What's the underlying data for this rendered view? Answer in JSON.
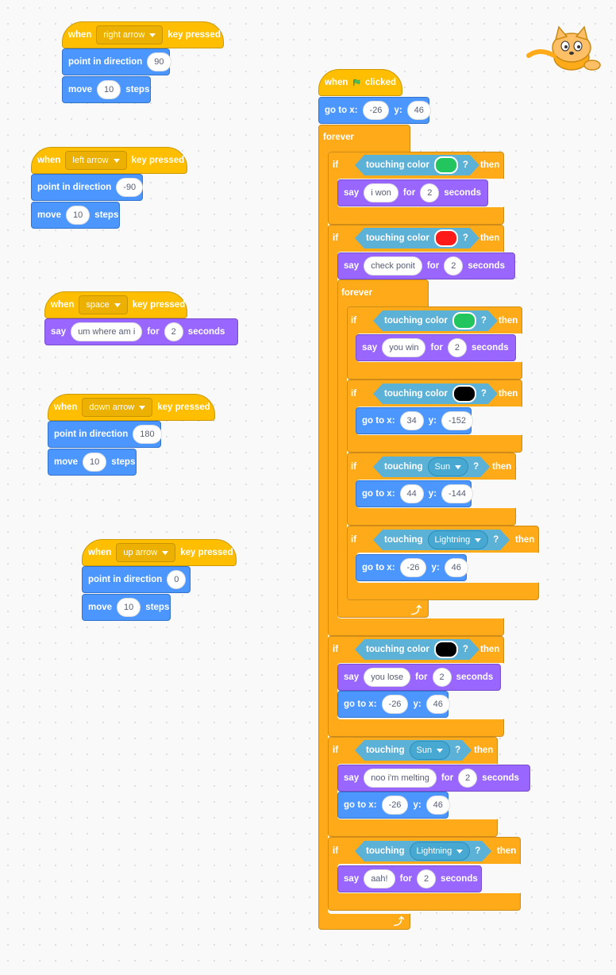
{
  "colors": {
    "event": "#ffbf00",
    "motion": "#4c97ff",
    "looks": "#9966ff",
    "control": "#ffab19",
    "sensing": "#5cb1d6",
    "green": "#22c55e",
    "red": "#ff1a1a",
    "black": "#000000"
  },
  "sprite": {
    "icon": "scratch-cat-icon"
  },
  "scripts": {
    "right": {
      "when": "when",
      "key": "right arrow",
      "pressed": "key pressed",
      "point": "point in direction",
      "dir": "90",
      "move": "move",
      "steps_val": "10",
      "steps": "steps"
    },
    "left": {
      "when": "when",
      "key": "left arrow",
      "pressed": "key pressed",
      "point": "point in direction",
      "dir": "-90",
      "move": "move",
      "steps_val": "10",
      "steps": "steps"
    },
    "space": {
      "when": "when",
      "key": "space",
      "pressed": "key pressed",
      "say": "say",
      "msg": "um where am i",
      "for": "for",
      "secs": "2",
      "seconds": "seconds"
    },
    "down": {
      "when": "when",
      "key": "down arrow",
      "pressed": "key pressed",
      "point": "point in direction",
      "dir": "180",
      "move": "move",
      "steps_val": "10",
      "steps": "steps"
    },
    "up": {
      "when": "when",
      "key": "up arrow",
      "pressed": "key pressed",
      "point": "point in direction",
      "dir": "0",
      "move": "move",
      "steps_val": "10",
      "steps": "steps"
    }
  },
  "main": {
    "when": "when",
    "clicked": "clicked",
    "goto": "go to x:",
    "y": "y:",
    "x0": "-26",
    "y0": "46",
    "forever": "forever",
    "if": "if",
    "then": "then",
    "q": "?",
    "touching_color": "touching color",
    "touching": "touching",
    "say": "say",
    "for": "for",
    "seconds": "seconds",
    "two": "2",
    "msg_won": "i won",
    "msg_check": "check ponit",
    "msg_youwin": "you win",
    "msg_lose": "you lose",
    "msg_melt": "noo i'm melting",
    "msg_aah": "aah!",
    "sun": "Sun",
    "lightning": "Lightning",
    "gx1": "34",
    "gy1": "-152",
    "gx2": "44",
    "gy2": "-144",
    "gx3": "-26",
    "gy3": "46"
  }
}
